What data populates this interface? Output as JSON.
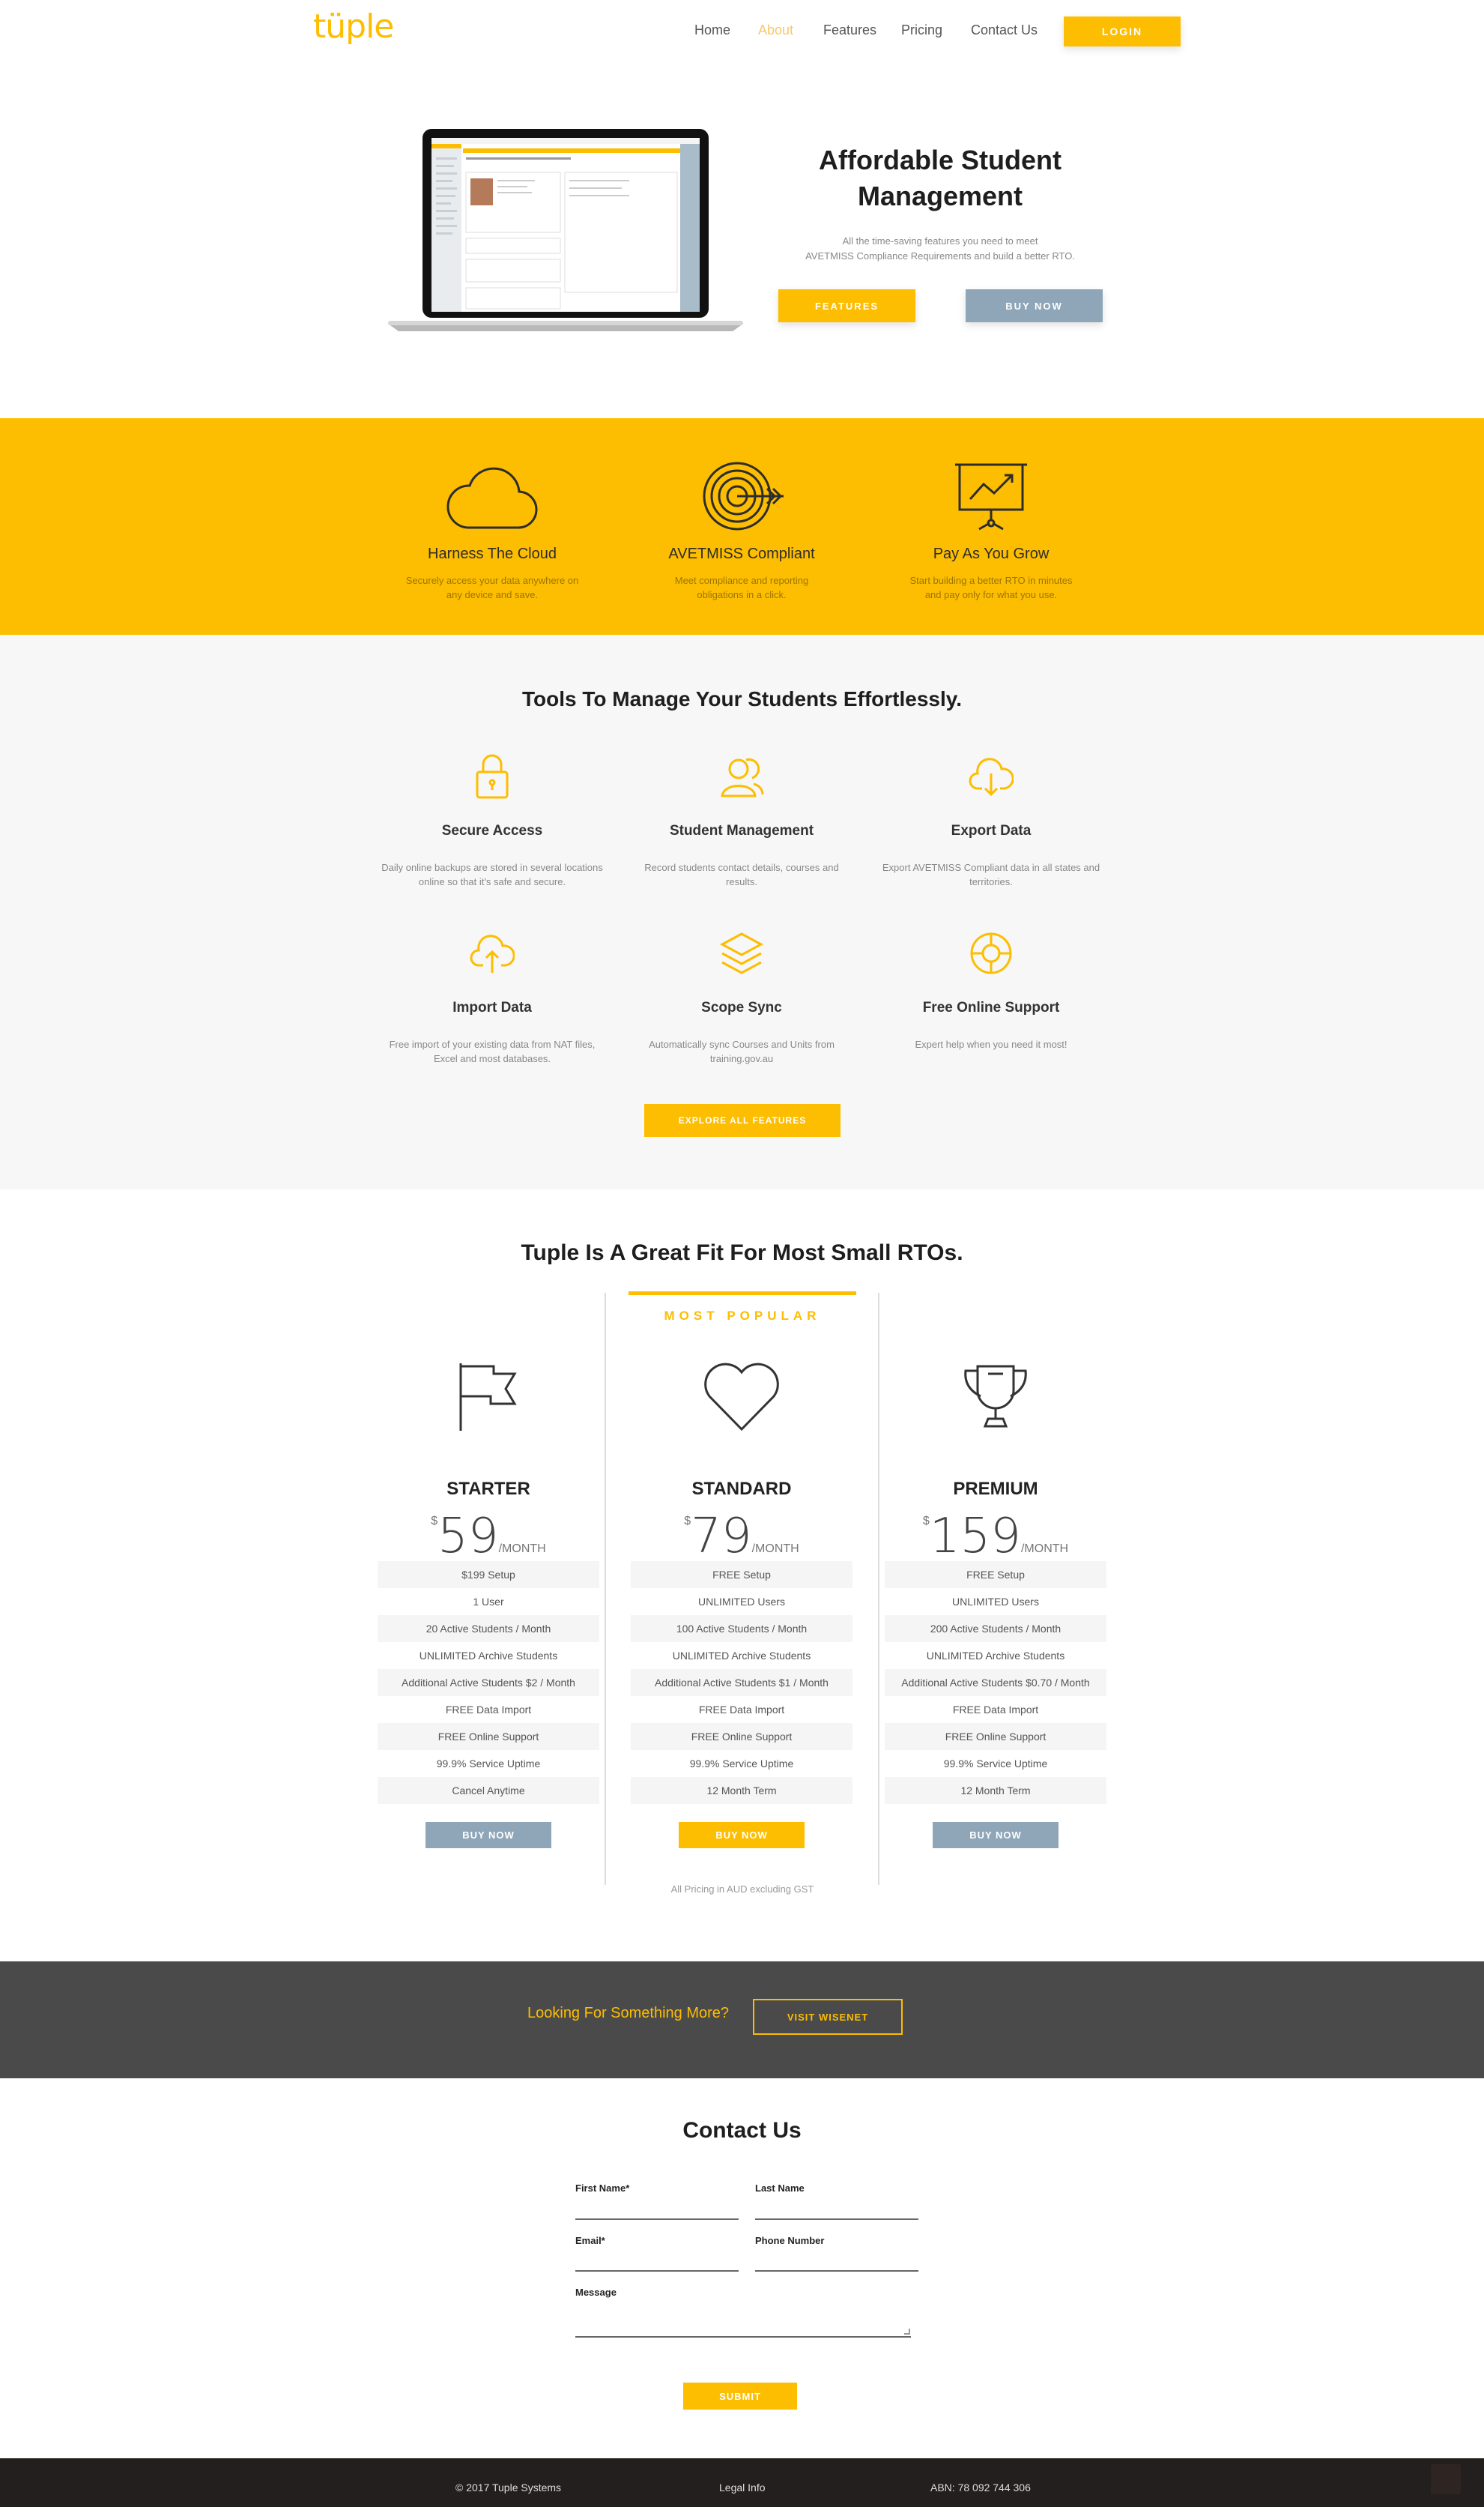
{
  "brand": {
    "logo": "tüple",
    "accent": "#fdbd00",
    "slate": "#8ea6b8"
  },
  "nav": {
    "items": [
      "Home",
      "About",
      "Features",
      "Pricing",
      "Contact Us"
    ],
    "active": "About",
    "login": "LOGIN"
  },
  "hero": {
    "title": "Affordable Student Management",
    "subtitle_line1": "All the time-saving features you need to meet",
    "subtitle_line2": "AVETMISS Compliance Requirements and build a better RTO.",
    "features_btn": "FEATURES",
    "buy_btn": "BUY NOW"
  },
  "band": [
    {
      "title": "Harness The Cloud",
      "desc": "Securely access your data anywhere on any device and save.",
      "icon": "cloud-icon"
    },
    {
      "title": "AVETMISS Compliant",
      "desc": "Meet compliance and reporting obligations in a click.",
      "icon": "target-icon"
    },
    {
      "title": "Pay As You Grow",
      "desc": "Start building a better RTO in minutes and pay only for what you use.",
      "icon": "chart-board-icon"
    }
  ],
  "tools": {
    "title": "Tools To Manage Your Students Effortlessly.",
    "items": [
      {
        "title": "Secure Access",
        "desc": "Daily online backups are stored in several locations online so that it's safe and secure.",
        "icon": "lock-icon"
      },
      {
        "title": "Student Management",
        "desc": "Record students contact details, courses and results.",
        "icon": "users-icon"
      },
      {
        "title": "Export Data",
        "desc": "Export AVETMISS Compliant data in all states and territories.",
        "icon": "cloud-download-icon"
      },
      {
        "title": "Import Data",
        "desc": "Free import of your existing data from NAT files, Excel and most databases.",
        "icon": "cloud-upload-icon"
      },
      {
        "title": "Scope Sync",
        "desc": "Automatically sync Courses and Units from training.gov.au",
        "icon": "layers-icon"
      },
      {
        "title": "Free Online Support",
        "desc": "Expert help when you need it most!",
        "icon": "lifebuoy-icon"
      }
    ],
    "explore_btn": "EXPLORE ALL FEATURES"
  },
  "pricing": {
    "title": "Tuple Is A Great Fit For Most Small RTOs.",
    "popular_label": "MOST POPULAR",
    "currency": "$",
    "per": "/MONTH",
    "note": "All Pricing in AUD excluding GST",
    "plans": [
      {
        "name": "STARTER",
        "price": "59",
        "button": "BUY NOW",
        "icon": "flag-icon",
        "features": [
          "$199 Setup",
          "1 User",
          "20 Active Students / Month",
          "UNLIMITED Archive Students",
          "Additional Active Students $2 / Month",
          "FREE Data Import",
          "FREE Online Support",
          "99.9% Service Uptime",
          "Cancel Anytime"
        ]
      },
      {
        "name": "STANDARD",
        "price": "79",
        "button": "BUY NOW",
        "icon": "heart-icon",
        "features": [
          "FREE Setup",
          "UNLIMITED Users",
          "100 Active Students / Month",
          "UNLIMITED Archive Students",
          "Additional Active Students $1 / Month",
          "FREE Data Import",
          "FREE Online Support",
          "99.9% Service Uptime",
          "12 Month Term"
        ]
      },
      {
        "name": "PREMIUM",
        "price": "159",
        "button": "BUY NOW",
        "icon": "trophy-icon",
        "features": [
          "FREE Setup",
          "UNLIMITED Users",
          "200 Active Students / Month",
          "UNLIMITED Archive Students",
          "Additional Active Students $0.70 / Month",
          "FREE Data Import",
          "FREE Online Support",
          "99.9% Service Uptime",
          "12 Month Term"
        ]
      }
    ]
  },
  "cta": {
    "text": "Looking For Something More?",
    "button": "VISIT WISENET"
  },
  "contact": {
    "title": "Contact Us",
    "first_name": "First Name*",
    "last_name": "Last Name",
    "email": "Email*",
    "phone": "Phone Number",
    "message": "Message",
    "submit": "SUBMIT"
  },
  "footer": {
    "copyright": "© 2017 Tuple Systems",
    "legal": "Legal Info",
    "abn": "ABN: 78 092 744 306"
  }
}
